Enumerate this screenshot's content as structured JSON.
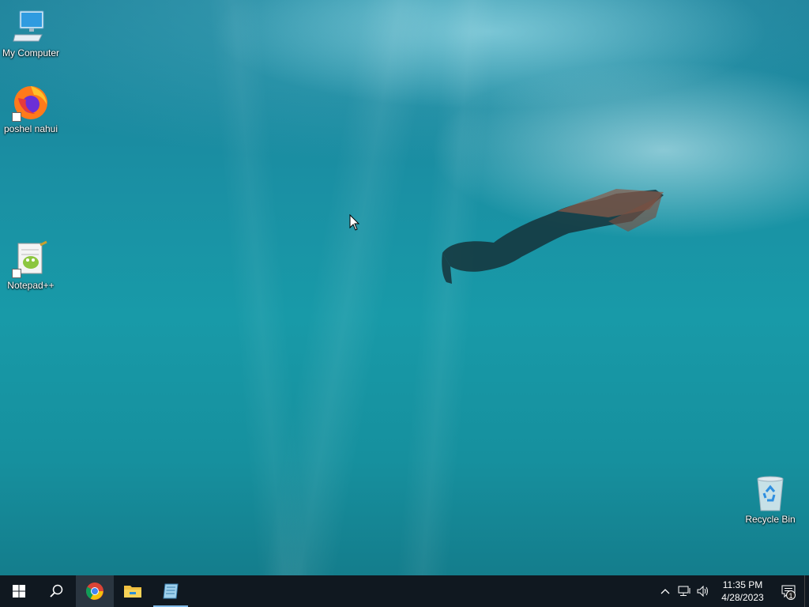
{
  "desktop": {
    "icons": [
      {
        "label": "My Computer",
        "icon": "monitor-icon"
      },
      {
        "label": "poshel nahui",
        "icon": "firefox-icon",
        "shortcut": true
      },
      {
        "label": "Notepad++",
        "icon": "notepadpp-icon",
        "shortcut": true
      },
      {
        "label": "Recycle Bin",
        "icon": "recycle-bin-icon"
      }
    ]
  },
  "taskbar": {
    "buttons": [
      {
        "name": "start",
        "icon": "windows-logo-icon"
      },
      {
        "name": "search",
        "icon": "search-icon"
      },
      {
        "name": "chrome",
        "icon": "chrome-icon",
        "active": true
      },
      {
        "name": "file-explorer",
        "icon": "folder-icon"
      },
      {
        "name": "notepad",
        "icon": "notepad-icon",
        "open": true
      }
    ],
    "tray": {
      "icons": [
        "chevron-up-icon",
        "network-icon",
        "volume-icon"
      ],
      "time": "11:35 PM",
      "date": "4/28/2023",
      "notification_count": "1"
    }
  },
  "colors": {
    "taskbar_bg": "#101820",
    "water_top": "#1b7f98",
    "water_bottom": "#147d8c",
    "active_indicator": "#7fb8e6"
  }
}
